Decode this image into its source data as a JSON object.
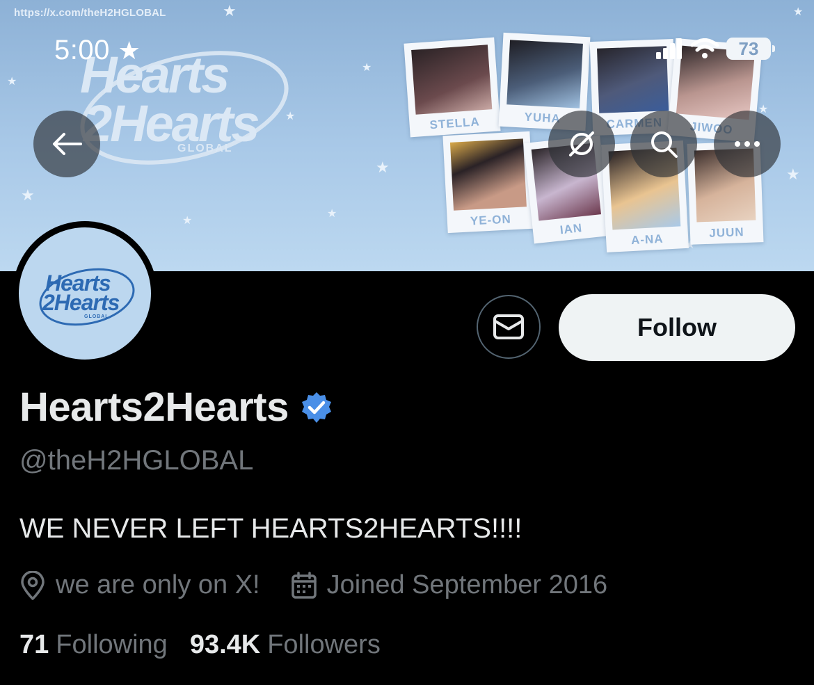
{
  "banner": {
    "url_watermark": "https://x.com/theH2HGLOBAL",
    "logo_line1": "Hearts",
    "logo_line2": "2Hearts",
    "logo_sub": "GLOBAL",
    "members": [
      "STELLA",
      "YUHA",
      "CARMEN",
      "JIWOO",
      "YE-ON",
      "IAN",
      "A-NA",
      "JUUN"
    ]
  },
  "status_bar": {
    "time": "5:00",
    "battery": "73"
  },
  "nav": {
    "back_icon": "arrow-left-icon",
    "feed_icon": "no-notifications-icon",
    "search_icon": "search-icon",
    "more_icon": "more-icon"
  },
  "avatar": {
    "line1": "Hearts",
    "line2": "2Hearts",
    "sub": "GLOBAL"
  },
  "actions": {
    "message_icon": "envelope-icon",
    "follow_label": "Follow"
  },
  "profile": {
    "display_name": "Hearts2Hearts",
    "handle": "@theH2HGLOBAL",
    "bio": "WE NEVER LEFT HEARTS2HEARTS!!!!",
    "location": "we are only on X!",
    "joined": "Joined September 2016",
    "following_count": "71",
    "following_label": "Following",
    "followers_count": "93.4K",
    "followers_label": "Followers"
  },
  "colors": {
    "verified": "#4a8fe7",
    "banner_sky": "#a9c9e8",
    "muted_text": "#71767b"
  }
}
